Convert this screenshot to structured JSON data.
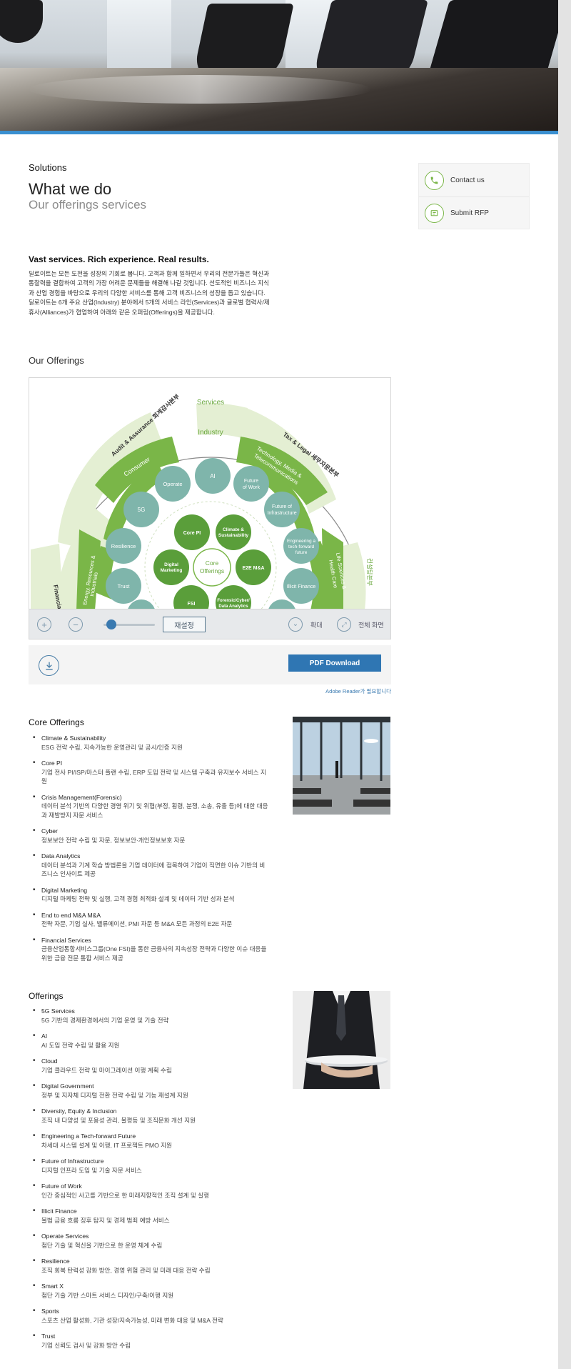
{
  "header": {
    "section_label": "Solutions",
    "title": "What we do",
    "subtitle": "Our offerings services"
  },
  "sidebar": {
    "contact_label": "Contact us",
    "rfp_label": "Submit RFP"
  },
  "intro": {
    "heading": "Vast services. Rich experience. Real results.",
    "body": "딜로이트는 모든 도전을 성장의 기회로 봅니다. 고객과 함께 일하면서 우리의 전문가들은 혁신과 통찰력을 결합하여 고객의 가장 어려운 문제들을 해결해 나갈 것입니다. 선도적인 비즈니스 지식과 산업 경험을 바탕으로 우리의 다양한 서비스를 통해 고객 비즈니스의 성장을 돕고 있습니다. 딜로이트는 6개 주요 산업(Industry) 분야에서 5개의 서비스 라인(Services)과 글로벌 협력사/제휴사(Alliances)가 협업하여 아래와 같은 오퍼링(Offerings)을 제공합니다."
  },
  "offerings_section": {
    "heading": "Our Offerings",
    "diagram": {
      "services_label": "Services",
      "industry_label": "Industry",
      "audit": "Audit & Assurance 회계감사본부",
      "tax": "Tax & Legal 세무자문본부",
      "financial": "Financial A",
      "consulting_right": "컨설팅본부",
      "consumer": "Consumer",
      "tmt_line1": "Technology, Media &",
      "tmt_line2": "Telecommunications",
      "energy_line1": "Energy, Resources &",
      "energy_line2": "Industrials",
      "life_line1": "Life Sciences &",
      "life_line2": "Health Care",
      "center_line1": "Core",
      "center_line2": "Offerings",
      "outer": {
        "operate": "Operate",
        "ai": "AI",
        "future_work_1": "Future",
        "future_work_2": "of Work",
        "g5": "5G",
        "future_infra_1": "Future of",
        "future_infra_2": "Infrastructure",
        "resilience": "Resilience",
        "eng_1": "Engineering a",
        "eng_2": "tech-forward",
        "eng_3": "future",
        "trust": "Trust",
        "illicit": "Illicit Finance"
      },
      "core": {
        "core_pi": "Core PI",
        "climate_1": "Climate &",
        "climate_2": "Sustainability",
        "digital_1": "Digital",
        "digital_2": "Marketing",
        "e2e": "E2E M&A",
        "fsi": "FSI",
        "forensic_1": "Forensic/Cyber/",
        "forensic_2": "Data Analytics"
      }
    },
    "toolbar": {
      "zoom_in_icon": "+",
      "zoom_out_icon": "−",
      "reset_label": "재설정",
      "expand_label": "확대",
      "fullscreen_label": "전체 화면"
    },
    "pdf": {
      "button_label": "PDF Download",
      "adobe_note": "Adobe Reader가 필요합니다"
    }
  },
  "core_offerings": {
    "heading": "Core Offerings",
    "items": [
      {
        "title": "Climate & Sustainability",
        "desc": "ESG 전략 수립, 지속가능한 운영관리 및 공시/인증 지원"
      },
      {
        "title": "Core PI",
        "desc": "기업 전사 PI/ISP/마스터 플랜 수립, ERP 도입 전략 및 시스템 구축과 유지보수 서비스 지원"
      },
      {
        "title": "Crisis Management(Forensic)",
        "desc": "데이터 분석 기반의 다양한 경영 위기 및 위협(부정, 횡령, 분쟁, 소송, 유출 등)에 대한 대응과 재발방지 자문 서비스"
      },
      {
        "title": "Cyber",
        "desc": "정보보안 전략 수립 및 자문, 정보보안·개인정보보호 자문"
      },
      {
        "title": "Data Analytics",
        "desc": "데이터 분석과 기계 학습 방법론을 기업 데이터에 접목하여 기업이 직면한 이슈 기반의 비즈니스 인사이트 제공"
      },
      {
        "title": "Digital Marketing",
        "desc": "디지털 마케팅 전략 및 실행, 고객 경험 최적화 설계 및 데이터 기반 성과 분석"
      },
      {
        "title": "End to end M&A M&A",
        "desc": "전략 자문, 기업 실사, 밸류에이션, PMI 자문 등 M&A 모든 과정의 E2E 자문"
      },
      {
        "title": "Financial Services",
        "desc": "금융산업통합서비스그룹(One FSI)을 통한 금융사의 지속성장 전략과 다양한 이슈 대응을 위한 금융 전문 통합 서비스 제공"
      }
    ]
  },
  "offerings": {
    "heading": "Offerings",
    "items": [
      {
        "title": "5G Services",
        "desc": "5G 기반의 경제환경에서의 기업 운영 및 기술 전략"
      },
      {
        "title": "AI",
        "desc": "AI 도입 전략 수립 및 활용 지원"
      },
      {
        "title": "Cloud",
        "desc": "기업 클라우드 전략 및 마이그레이션 이행 계획 수립"
      },
      {
        "title": "Digital Government",
        "desc": "정부 및 지자체 디지털 전환 전략 수립 및 기능 재설계 지원"
      },
      {
        "title": "Diversity, Equity & Inclusion",
        "desc": "조직 내 다양성 및 포용성 관리, 불평등 및 조직문화 개선 지원"
      },
      {
        "title": "Engineering a Tech-forward Future",
        "desc": "차세대 시스템 설계 및 이행, IT 프로젝트 PMO 지원"
      },
      {
        "title": "Future of Infrastructure",
        "desc": "디지털 인프라 도입 및 기술 자문 서비스"
      },
      {
        "title": "Future of Work",
        "desc": "인간 중심적인 사고를 기반으로 한 미래지향적인 조직 설계 및 실행"
      },
      {
        "title": "Illicit Finance",
        "desc": "불법 금융 흐름 징후 탐지 및 경제 범죄 예방 서비스"
      },
      {
        "title": "Operate Services",
        "desc": "첨단 기술 및 혁신을 기반으로 한 운영 체계 수립"
      },
      {
        "title": "Resilience",
        "desc": "조직 회복 탄력성 강화 방안, 경영 위험 관리 및 미래 대응 전략 수립"
      },
      {
        "title": "Smart X",
        "desc": "첨단 기술 기반 스마트 서비스 디자인/구축/이행 지원"
      },
      {
        "title": "Sports",
        "desc": "스포츠 산업 활성화, 기관 성장/지속가능성, 미래 변화 대응 및 M&A 전략"
      },
      {
        "title": "Trust",
        "desc": "기업 신뢰도 검사 및 강화 방안 수립"
      }
    ]
  },
  "colors": {
    "accent_blue": "#3a8fd0",
    "button_blue": "#2f76b3",
    "green": "#7ab648",
    "teal": "#7fb5ab",
    "dark_green": "#5a9e3a"
  }
}
